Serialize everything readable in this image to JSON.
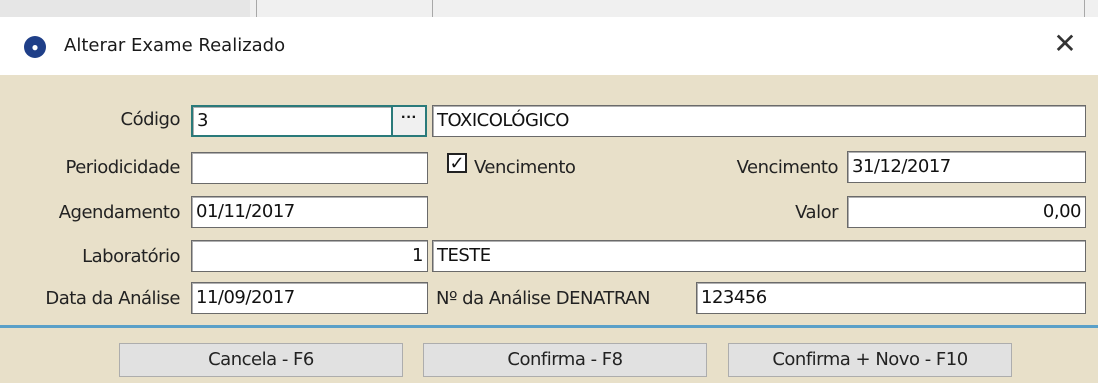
{
  "window": {
    "title": "Alterar Exame Realizado",
    "close_icon": "close-icon",
    "app_icon": "app-logo-icon"
  },
  "form": {
    "codigo": {
      "label": "Código",
      "value": "3",
      "description": "TOXICOLÓGICO",
      "lookup_label": "···"
    },
    "periodicidade": {
      "label": "Periodicidade",
      "value": ""
    },
    "vencimento_check": {
      "label": "Vencimento",
      "checked": true,
      "mark": "✓"
    },
    "vencimento": {
      "label": "Vencimento",
      "value": "31/12/2017"
    },
    "agendamento": {
      "label": "Agendamento",
      "value": "01/11/2017"
    },
    "valor": {
      "label": "Valor",
      "value": "0,00"
    },
    "laboratorio": {
      "label": "Laboratório",
      "code": "1",
      "name": "TESTE"
    },
    "data_analise": {
      "label": "Data da Análise",
      "value": "11/09/2017"
    },
    "analise_denatran": {
      "label": "Nº da Análise DENATRAN",
      "value": "123456"
    }
  },
  "buttons": {
    "cancela": "Cancela - F6",
    "confirma": "Confirma - F8",
    "confirma_novo": "Confirma + Novo - F10"
  },
  "colors": {
    "panel": "#e8e0c9",
    "focus_border": "#2a7a7a",
    "separator": "#5aa0c8"
  }
}
